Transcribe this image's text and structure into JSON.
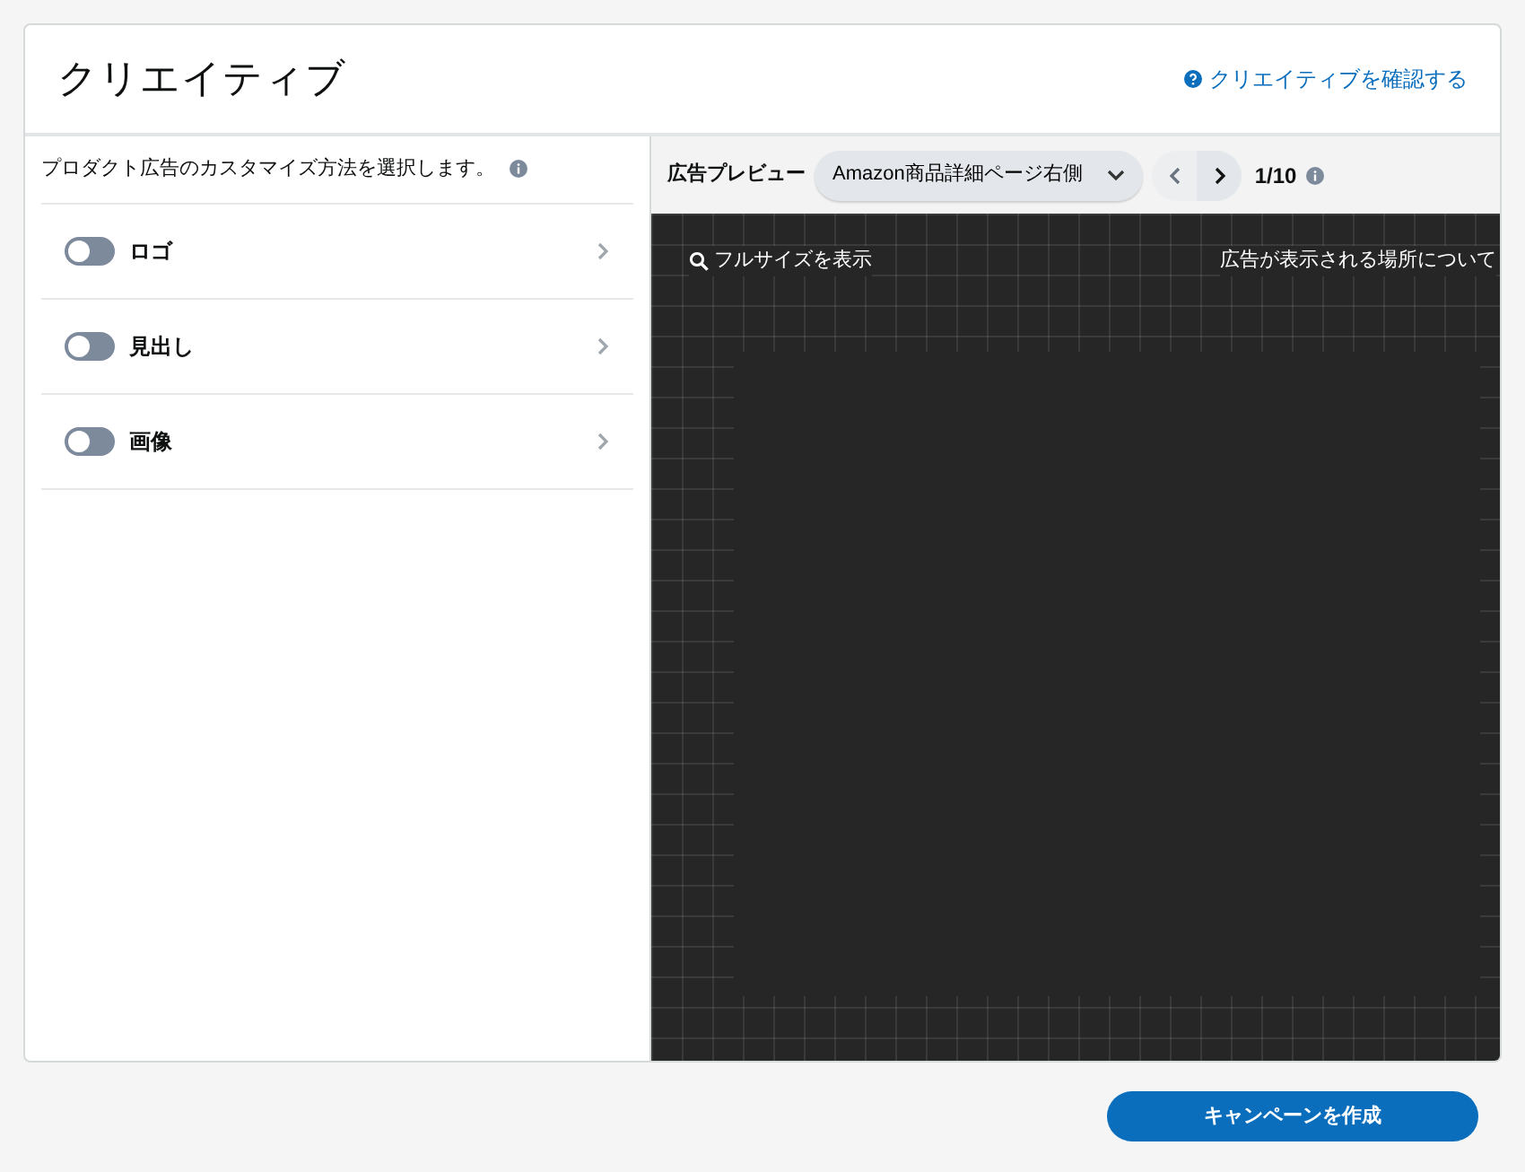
{
  "header": {
    "title": "クリエイティブ",
    "link": "クリエイティブを確認する"
  },
  "customize": {
    "description": "プロダクト広告のカスタマイズ方法を選択します。",
    "options": [
      {
        "label": "ロゴ",
        "on": false
      },
      {
        "label": "見出し",
        "on": false
      },
      {
        "label": "画像",
        "on": false
      }
    ]
  },
  "preview": {
    "label": "広告プレビュー",
    "placement": "Amazon商品詳細ページ右側",
    "prev_disabled": true,
    "counter": "1/10",
    "full_size_link": "フルサイズを表示",
    "about_link": "広告が表示される場所について"
  },
  "buttons": [
    {
      "label": "キャンペーンを作成"
    }
  ]
}
